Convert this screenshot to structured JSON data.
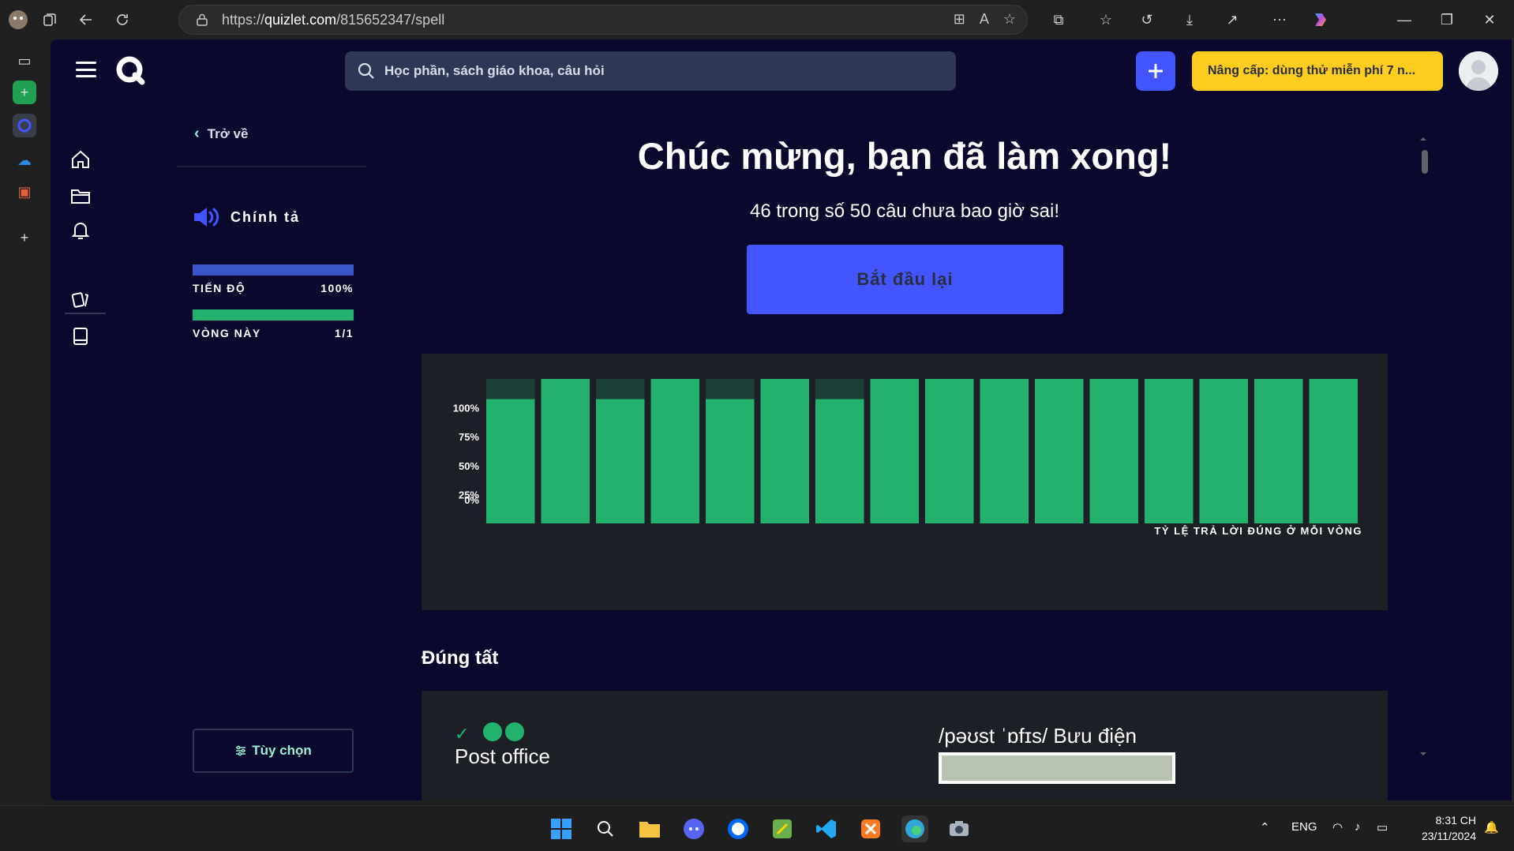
{
  "browser": {
    "url_prefix": "https://",
    "url_domain": "quizlet.com",
    "url_path": "/815652347/spell"
  },
  "nav": {
    "search_placeholder": "Học phần, sách giáo khoa, câu hỏi",
    "upgrade_label": "Nâng cấp: dùng thử miễn phí 7 n..."
  },
  "panel": {
    "back_label": "Trở về",
    "mode_label": "Chính tả",
    "progress_label": "TIẾN ĐỘ",
    "progress_value": "100%",
    "progress_fraction": 1.0,
    "round_label": "VÒNG NÀY",
    "round_value": "1/1",
    "round_fraction": 1.0,
    "options_label": "Tùy chọn"
  },
  "main": {
    "title": "Chúc mừng, bạn đã làm xong!",
    "subtitle": "46 trong số 50 câu chưa bao giờ sai!",
    "restart_label": "Bắt đầu lại",
    "section_title": "Đúng tất"
  },
  "chart_data": {
    "type": "bar",
    "title": "",
    "xlabel": "TỶ LỆ TRẢ LỜI ĐÚNG Ở MỖI VÒNG",
    "ylabel": "",
    "ylim": [
      0,
      100
    ],
    "yticks": [
      "100%",
      "75%",
      "50%",
      "25%",
      "0%"
    ],
    "values": [
      86,
      100,
      86,
      100,
      86,
      100,
      86,
      100,
      100,
      100,
      100,
      100,
      100,
      100,
      100,
      100
    ],
    "colors": {
      "correct": "#23b26d",
      "remainder": "#1b3f36"
    }
  },
  "term_card": {
    "term": "Post office",
    "definition": "/pəʊst ˈɒfɪs/ Bưu điện"
  },
  "taskbar": {
    "lang": "ENG",
    "time": "8:31 CH",
    "date": "23/11/2024"
  },
  "colors": {
    "app_bg": "#0a092d",
    "accent": "#4255ff",
    "success": "#23b26d",
    "upgrade": "#ffcd1f"
  }
}
